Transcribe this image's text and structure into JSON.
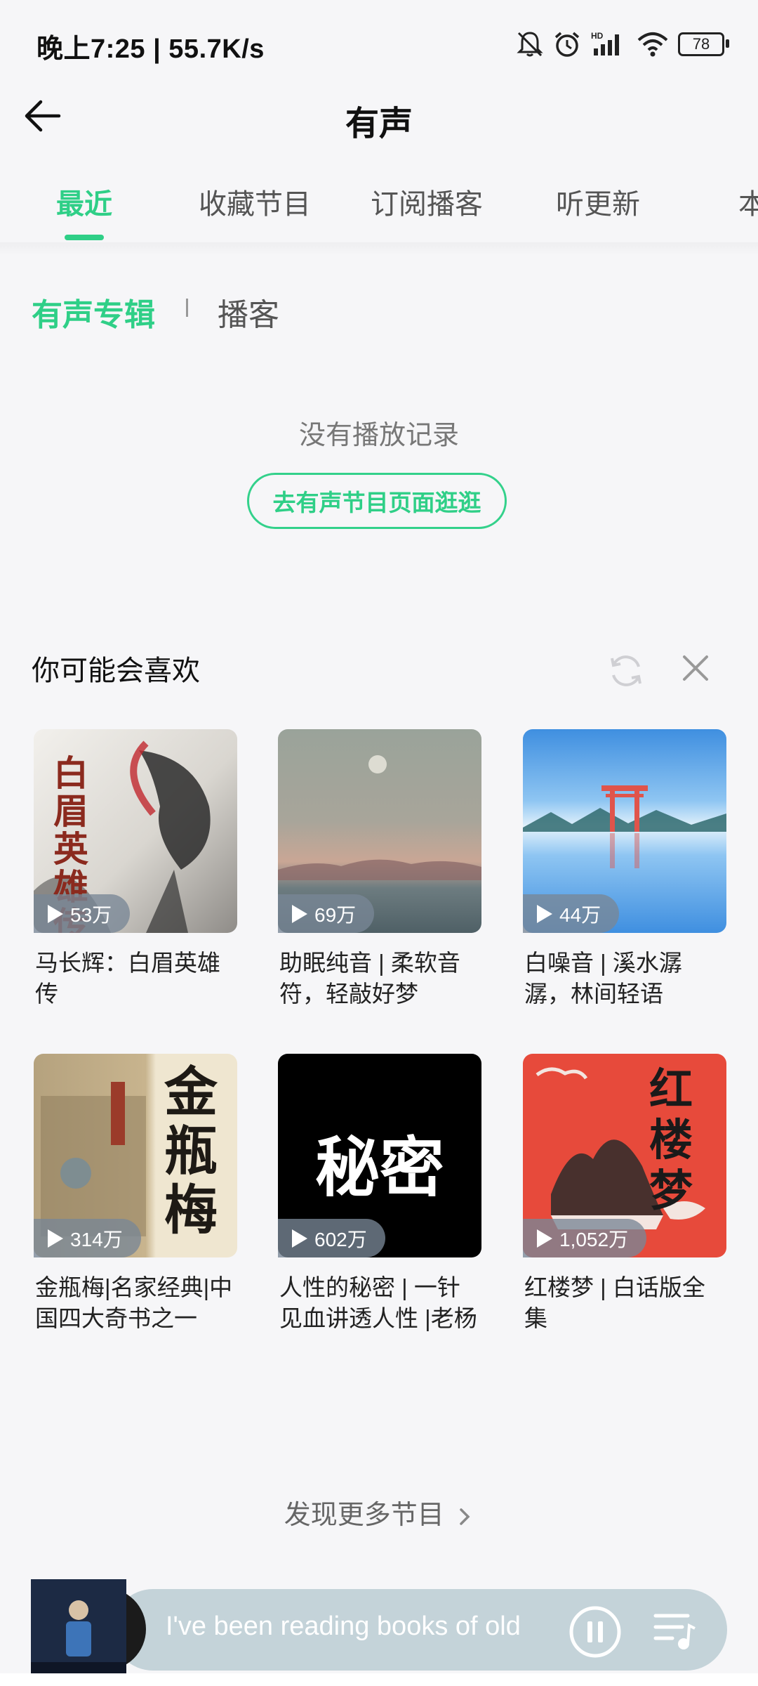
{
  "status": {
    "time": "晚上7:25 | 55.7K/s",
    "battery": "78",
    "icons": [
      "mute-icon",
      "alarm-icon",
      "hd-signal-icon",
      "wifi-icon",
      "battery-icon"
    ]
  },
  "header": {
    "title": "有声"
  },
  "tabs": [
    {
      "label": "最近",
      "active": true
    },
    {
      "label": "收藏节目"
    },
    {
      "label": "订阅播客"
    },
    {
      "label": "听更新"
    },
    {
      "label": "本"
    }
  ],
  "subtabs": {
    "active": "有声专辑",
    "other": "播客"
  },
  "empty": {
    "message": "没有播放记录",
    "button": "去有声节目页面逛逛"
  },
  "recommend": {
    "title": "你可能会喜欢",
    "items": [
      {
        "plays": "53万",
        "title": "马长辉：白眉英雄传",
        "cover_text": "白眉英雄传"
      },
      {
        "plays": "69万",
        "title": "助眠纯音 | 柔软音符，轻敲好梦"
      },
      {
        "plays": "44万",
        "title": "白噪音 | 溪水潺潺，林间轻语"
      },
      {
        "plays": "314万",
        "title": "金瓶梅|名家经典|中国四大奇书之一",
        "cover_text": "金瓶梅"
      },
      {
        "plays": "602万",
        "title": "人性的秘密 | 一针见血讲透人性 |老杨",
        "cover_text": "秘密"
      },
      {
        "plays": "1,052万",
        "title": "红楼梦 | 白话版全集",
        "cover_text": "红楼梦"
      }
    ]
  },
  "more": {
    "label": "发现更多节目"
  },
  "player": {
    "text": "I've been reading books of old"
  },
  "colors": {
    "accent": "#2fcf87",
    "background": "#f6f6f8",
    "player": "#c4d3d9"
  }
}
